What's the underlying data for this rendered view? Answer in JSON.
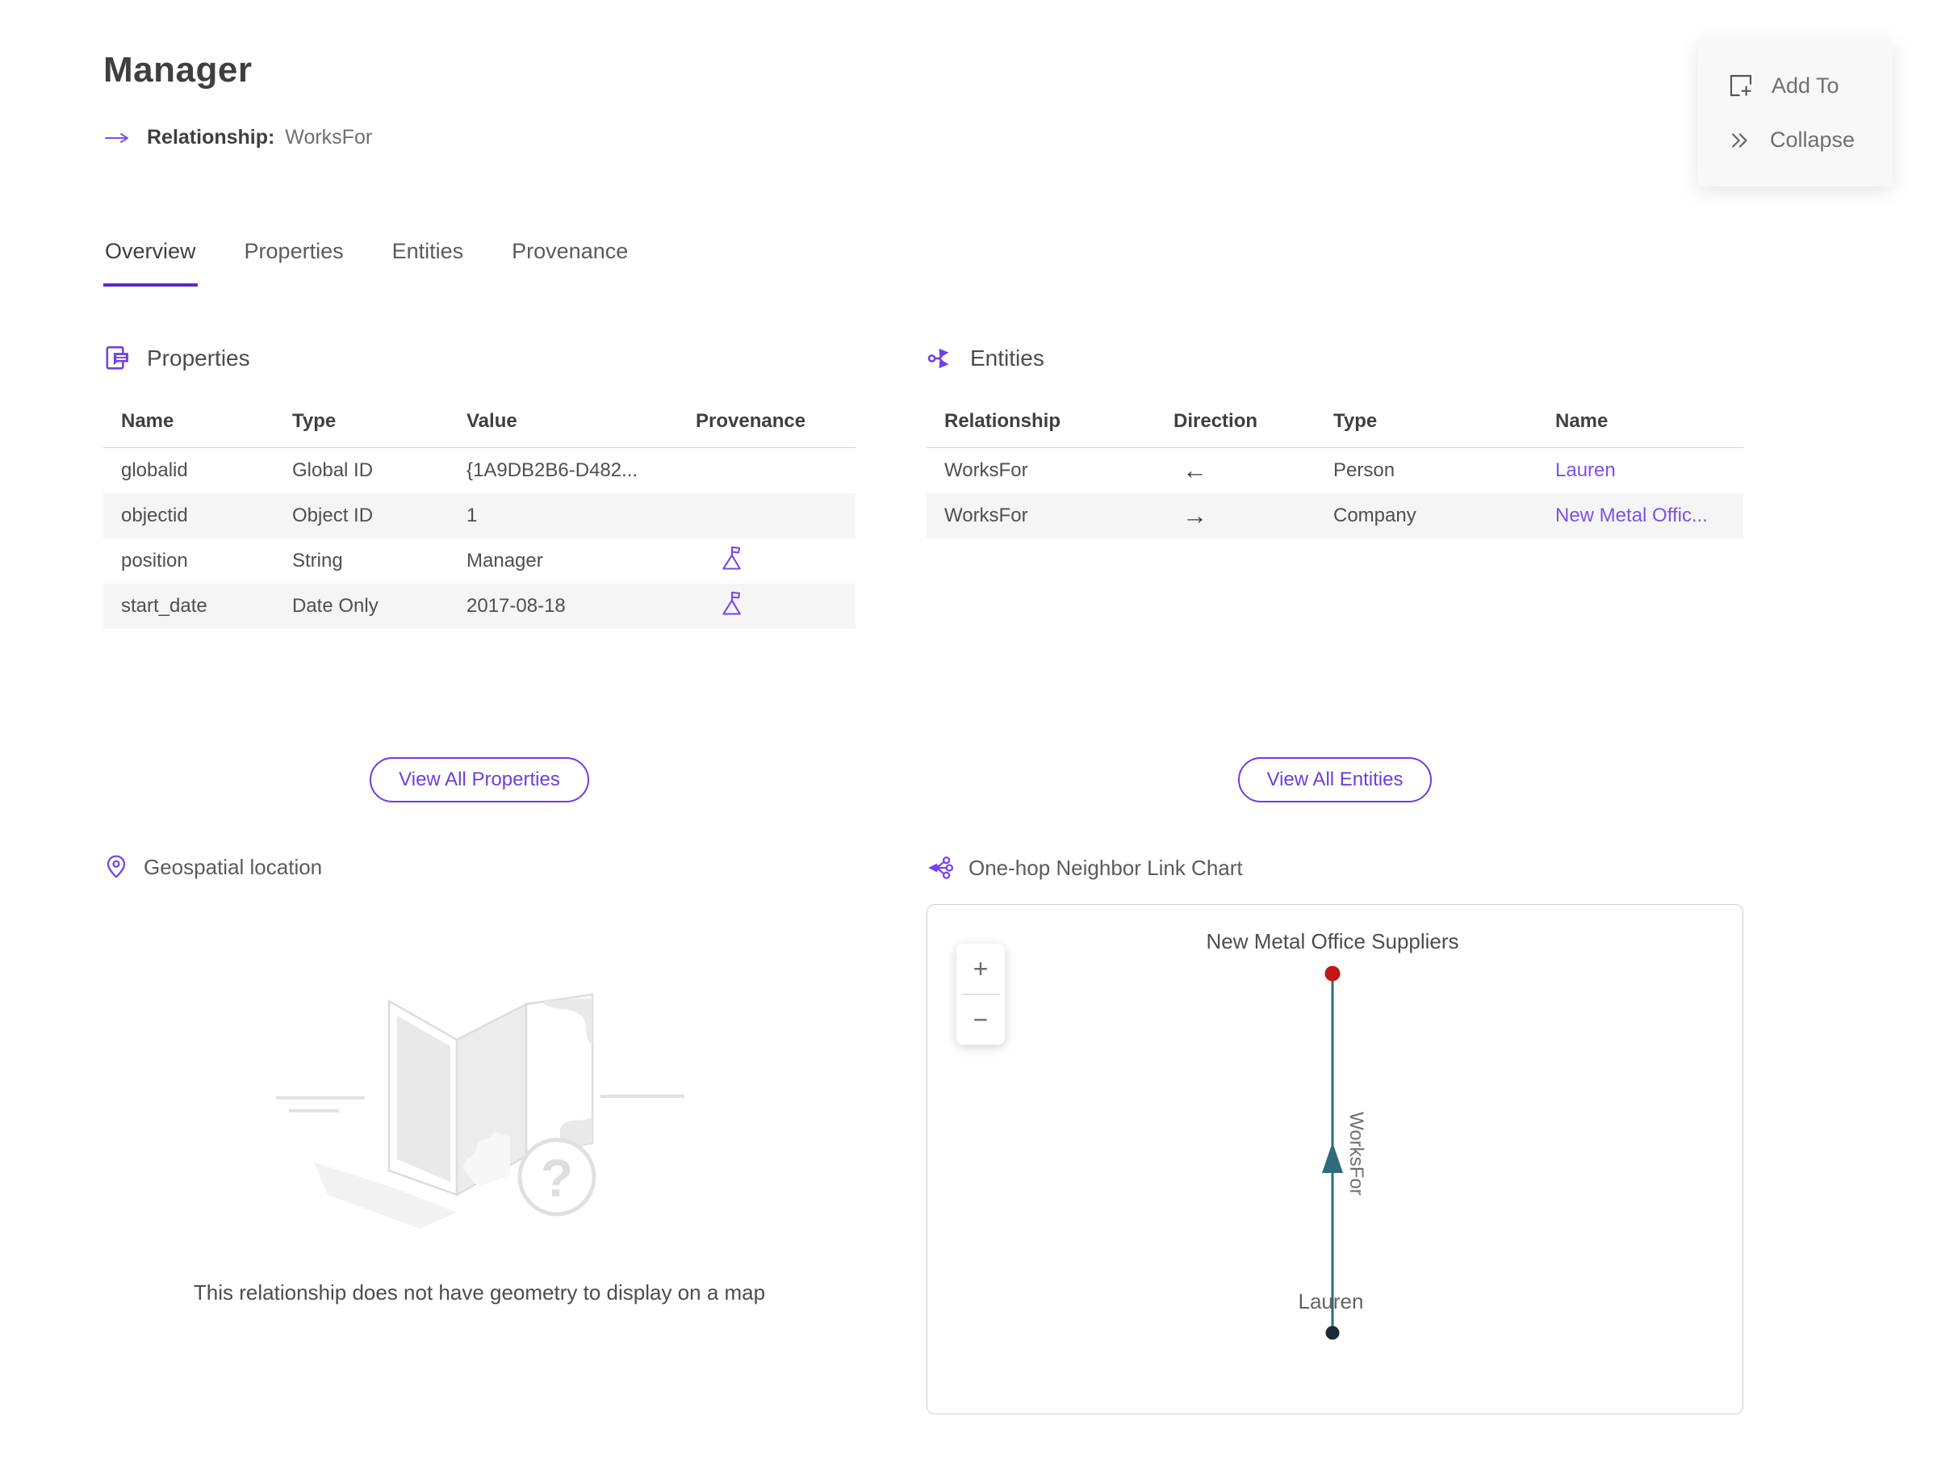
{
  "header": {
    "title": "Manager",
    "relationship_label": "Relationship:",
    "relationship_value": "WorksFor"
  },
  "actions": {
    "add_to": "Add To",
    "collapse": "Collapse"
  },
  "tabs": [
    {
      "label": "Overview",
      "active": true
    },
    {
      "label": "Properties",
      "active": false
    },
    {
      "label": "Entities",
      "active": false
    },
    {
      "label": "Provenance",
      "active": false
    }
  ],
  "properties_section": {
    "title": "Properties",
    "columns": [
      "Name",
      "Type",
      "Value",
      "Provenance"
    ],
    "rows": [
      {
        "name": "globalid",
        "type": "Global ID",
        "value": "{1A9DB2B6-D482...",
        "has_provenance": false
      },
      {
        "name": "objectid",
        "type": "Object ID",
        "value": "1",
        "has_provenance": false
      },
      {
        "name": "position",
        "type": "String",
        "value": "Manager",
        "has_provenance": true
      },
      {
        "name": "start_date",
        "type": "Date Only",
        "value": "2017-08-18",
        "has_provenance": true
      }
    ],
    "view_all_label": "View All Properties"
  },
  "entities_section": {
    "title": "Entities",
    "columns": [
      "Relationship",
      "Direction",
      "Type",
      "Name"
    ],
    "rows": [
      {
        "relationship": "WorksFor",
        "direction": "←",
        "type": "Person",
        "name": "Lauren"
      },
      {
        "relationship": "WorksFor",
        "direction": "→",
        "type": "Company",
        "name": "New Metal Offic..."
      }
    ],
    "view_all_label": "View All Entities"
  },
  "geospatial_section": {
    "title": "Geospatial location",
    "empty_message": "This relationship does not have geometry to display on a map"
  },
  "link_chart_section": {
    "title": "One-hop Neighbor Link Chart",
    "zoom_in_label": "+",
    "zoom_out_label": "−",
    "top_node": {
      "label": "New Metal Office Suppliers",
      "color": "#c01616"
    },
    "bottom_node": {
      "label": "Lauren",
      "color": "#1d2935"
    },
    "edge": {
      "label": "WorksFor",
      "color": "#2e6b7d"
    }
  },
  "colors": {
    "accent": "#6e42e4",
    "link": "#7a52e8",
    "tab_underline": "#5b2cc4",
    "row_alt_background": "#f5f5f5",
    "node_red": "#c01616",
    "node_dark": "#1d2935",
    "edge_teal": "#2e6b7d"
  }
}
